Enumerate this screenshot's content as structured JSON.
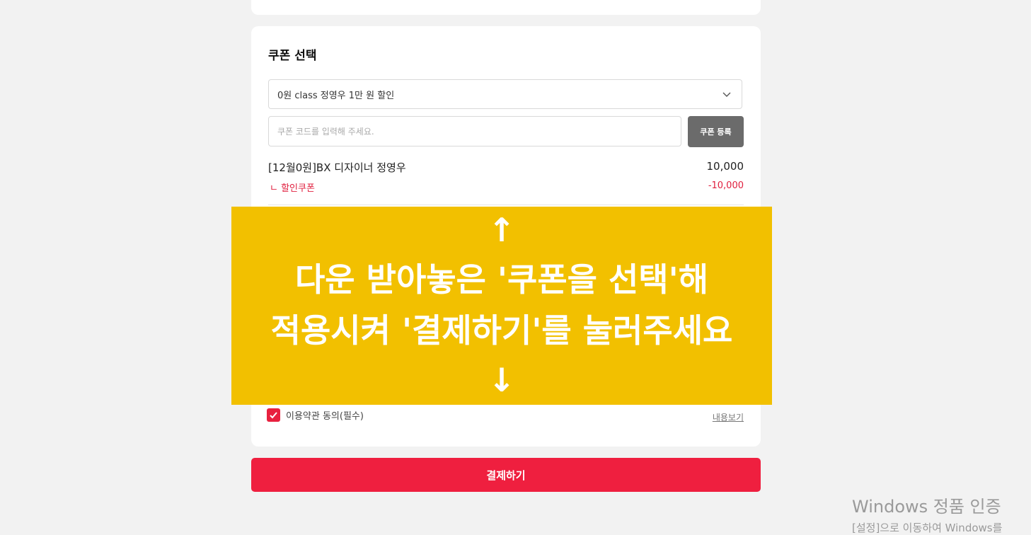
{
  "coupon_section": {
    "title": "쿠폰 선택",
    "selected_coupon": "0원 class 정영우 1만 원 할인",
    "code_placeholder": "쿠폰 코드를 입력해 주세요.",
    "register_label": "쿠폰 등록"
  },
  "order": {
    "product_name": "[12월0원]BX 디자이너 정영우",
    "product_price": "10,000",
    "discount_label": "ㄴ 할인쿠폰",
    "discount_value": "-10,000"
  },
  "terms": {
    "label": "이용약관 동의(필수)",
    "view_label": "내용보기",
    "checked": true
  },
  "pay_label": "결제하기",
  "overlay": {
    "arrow_up": "↑",
    "line1": "다운 받아놓은 '쿠폰을 선택'해",
    "line2": "적용시켜 '결제하기'를 눌러주세요",
    "arrow_down": "↓",
    "color": "#f2c000"
  },
  "watermark": {
    "title": "Windows 정품 인증",
    "subtitle": "[설정]으로 이동하여 Windows를"
  },
  "colors": {
    "accent": "#ef1f3f",
    "button_gray": "#6b6b6b"
  }
}
